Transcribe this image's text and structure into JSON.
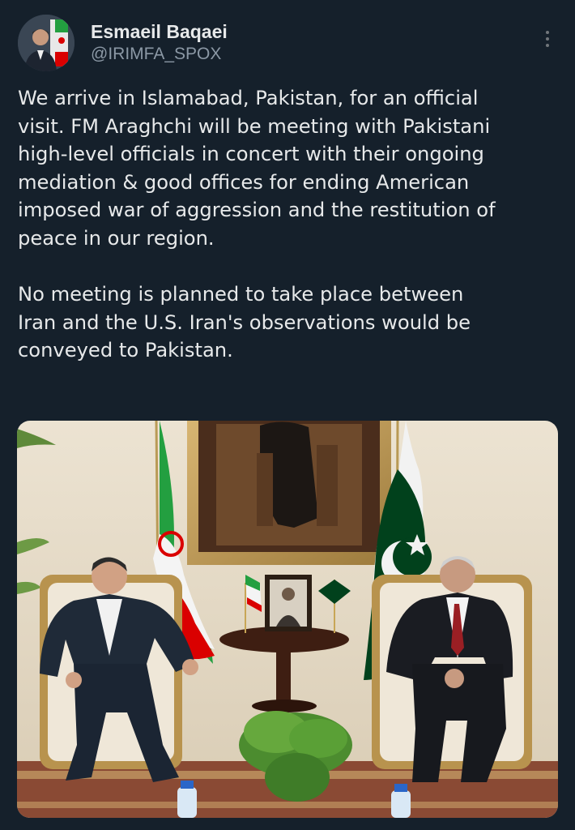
{
  "author": {
    "display_name": "Esmaeil Baqaei",
    "handle": "@IRIMFA_SPOX",
    "avatar_icon": "profile-photo-avatar"
  },
  "more_icon": "more-vertical-icon",
  "tweet": {
    "paragraph_1_lines": [
      "We arrive in Islamabad, Pakistan, for an official",
      "visit. FM Araghchi will be meeting with Pakistani",
      "high-level officials in concert with their ongoing",
      "mediation & good offices for ending American",
      "imposed war of aggression and the restitution of",
      "peace in our region."
    ],
    "paragraph_2_lines": [
      "No meeting is planned to take place between",
      "Iran and the U.S. Iran's observations would be",
      "conveyed to Pakistan."
    ]
  },
  "colors": {
    "background": "#15202b",
    "primary_text": "#e7e9ea",
    "secondary_text": "#8b98a5",
    "iran_green": "#239f40",
    "iran_red": "#da0000",
    "pakistan_green": "#01411c"
  }
}
